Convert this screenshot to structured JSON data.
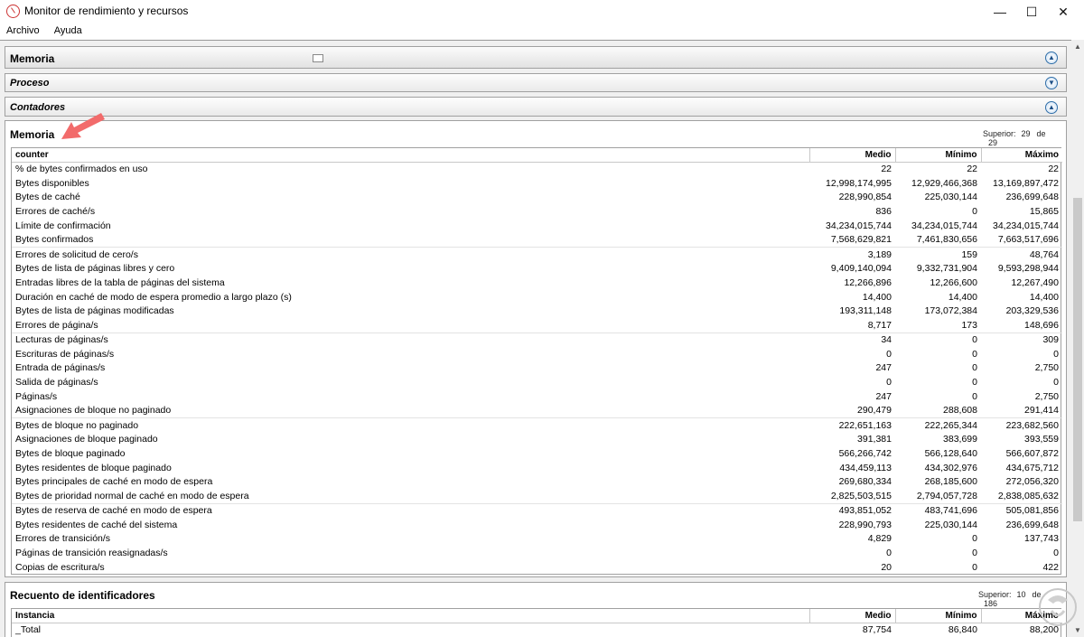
{
  "window": {
    "title": "Monitor de rendimiento y recursos",
    "controls": {
      "minimize": "—",
      "maximize": "☐",
      "close": "✕"
    }
  },
  "menu": [
    "Archivo",
    "Ayuda"
  ],
  "sections": {
    "memoria_header": "Memoria",
    "proceso_header": "Proceso",
    "contadores_header": "Contadores"
  },
  "memory_panel": {
    "title": "Memoria",
    "superior_label": "Superior:",
    "superior_value": "29",
    "de_label": "de",
    "de_value": "29",
    "columns": [
      "counter",
      "Medio",
      "Mínimo",
      "Máximo"
    ],
    "rows": [
      [
        "% de bytes confirmados en uso",
        "22",
        "22",
        "22"
      ],
      [
        "Bytes disponibles",
        "12,998,174,995",
        "12,929,466,368",
        "13,169,897,472"
      ],
      [
        "Bytes de caché",
        "228,990,854",
        "225,030,144",
        "236,699,648"
      ],
      [
        "Errores de caché/s",
        "836",
        "0",
        "15,865"
      ],
      [
        "Límite de confirmación",
        "34,234,015,744",
        "34,234,015,744",
        "34,234,015,744"
      ],
      [
        "Bytes confirmados",
        "7,568,629,821",
        "7,461,830,656",
        "7,663,517,696"
      ],
      [
        "Errores de solicitud de cero/s",
        "3,189",
        "159",
        "48,764"
      ],
      [
        "Bytes de lista de páginas libres y cero",
        "9,409,140,094",
        "9,332,731,904",
        "9,593,298,944"
      ],
      [
        "Entradas libres de la tabla de páginas del sistema",
        "12,266,896",
        "12,266,600",
        "12,267,490"
      ],
      [
        "Duración en caché de modo de espera promedio a largo plazo (s)",
        "14,400",
        "14,400",
        "14,400"
      ],
      [
        "Bytes de lista de páginas modificadas",
        "193,311,148",
        "173,072,384",
        "203,329,536"
      ],
      [
        "Errores de página/s",
        "8,717",
        "173",
        "148,696"
      ],
      [
        "Lecturas de páginas/s",
        "34",
        "0",
        "309"
      ],
      [
        "Escrituras de páginas/s",
        "0",
        "0",
        "0"
      ],
      [
        "Entrada de páginas/s",
        "247",
        "0",
        "2,750"
      ],
      [
        "Salida de páginas/s",
        "0",
        "0",
        "0"
      ],
      [
        "Páginas/s",
        "247",
        "0",
        "2,750"
      ],
      [
        "Asignaciones de bloque no paginado",
        "290,479",
        "288,608",
        "291,414"
      ],
      [
        "Bytes de bloque no paginado",
        "222,651,163",
        "222,265,344",
        "223,682,560"
      ],
      [
        "Asignaciones de bloque paginado",
        "391,381",
        "383,699",
        "393,559"
      ],
      [
        "Bytes de bloque paginado",
        "566,266,742",
        "566,128,640",
        "566,607,872"
      ],
      [
        "Bytes residentes de bloque paginado",
        "434,459,113",
        "434,302,976",
        "434,675,712"
      ],
      [
        "Bytes principales de caché en modo de espera",
        "269,680,334",
        "268,185,600",
        "272,056,320"
      ],
      [
        "Bytes de prioridad normal de caché en modo de espera",
        "2,825,503,515",
        "2,794,057,728",
        "2,838,085,632"
      ],
      [
        "Bytes de reserva de caché en modo de espera",
        "493,851,052",
        "483,741,696",
        "505,081,856"
      ],
      [
        "Bytes residentes de caché del sistema",
        "228,990,793",
        "225,030,144",
        "236,699,648"
      ],
      [
        "Errores de transición/s",
        "4,829",
        "0",
        "137,743"
      ],
      [
        "Páginas de transición reasignadas/s",
        "0",
        "0",
        "0"
      ],
      [
        "Copias de escritura/s",
        "20",
        "0",
        "422"
      ]
    ]
  },
  "handles_panel": {
    "title": "Recuento de identificadores",
    "superior_label": "Superior:",
    "superior_value": "10",
    "de_label": "de",
    "de_value": "186",
    "columns": [
      "Instancia",
      "Medio",
      "Mínimo",
      "Máximo"
    ],
    "rows": [
      [
        "_Total",
        "87,754",
        "86,840",
        "88,200"
      ]
    ]
  },
  "colors": {
    "annotation_arrow": "#f26b6b",
    "accent_button": "#2f6ea8"
  }
}
